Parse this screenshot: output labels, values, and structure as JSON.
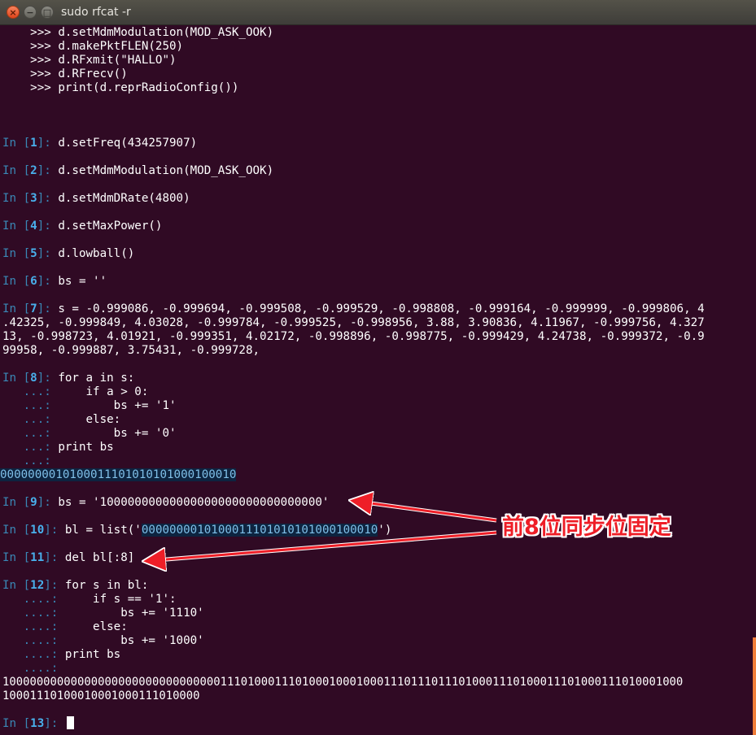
{
  "window": {
    "title": "sudo rfcat -r",
    "close_glyph": "×",
    "min_glyph": "−",
    "max_glyph": "□"
  },
  "colors": {
    "background": "#300a24",
    "prompt": "#3a88b6",
    "prompt_num": "#49b0ec",
    "annotation": "#ee1e27"
  },
  "annotation": "前8位同步位固定",
  "preamble": [
    "    >>> d.setMdmModulation(MOD_ASK_OOK)",
    "    >>> d.makePktFLEN(250)",
    "    >>> d.RFxmit(\"HALLO\")",
    "    >>> d.RFrecv()",
    "    >>> print(d.reprRadioConfig())"
  ],
  "cells": {
    "c1": {
      "num": "1",
      "code": "d.setFreq(434257907)"
    },
    "c2": {
      "num": "2",
      "code": "d.setMdmModulation(MOD_ASK_OOK)"
    },
    "c3": {
      "num": "3",
      "code": "d.setMdmDRate(4800)"
    },
    "c4": {
      "num": "4",
      "code": "d.setMaxPower()"
    },
    "c5": {
      "num": "5",
      "code": "d.lowball()"
    },
    "c6": {
      "num": "6",
      "code": "bs = ''"
    },
    "c7": {
      "num": "7",
      "code": "s = -0.999086, -0.999694, -0.999508, -0.999529, -0.998808, -0.999164, -0.999999, -0.999806, 4",
      "wrap1": ".42325, -0.999849, 4.03028, -0.999784, -0.999525, -0.998956, 3.88, 3.90836, 4.11967, -0.999756, 4.327",
      "wrap2": "13, -0.998723, 4.01921, -0.999351, 4.02172, -0.998896, -0.998775, -0.999429, 4.24738, -0.999372, -0.9",
      "wrap3": "99958, -0.999887, 3.75431, -0.999728,"
    },
    "c8": {
      "num": "8",
      "code": "for a in s:",
      "cont_prompt": "   ...:",
      "l2": "     if a > 0:",
      "l3": "         bs += '1'",
      "l4": "     else:",
      "l5": "         bs += '0'",
      "l6": " print bs",
      "output": "0000000010100011101010101000100010"
    },
    "c9": {
      "num": "9",
      "code": "bs = '10000000000000000000000000000000'"
    },
    "c10": {
      "num": "10",
      "code_pre": "bl = list('",
      "code_hl": "0000000010100011101010101000100010",
      "code_post": "')"
    },
    "c11": {
      "num": "11",
      "code": "del bl[:8]"
    },
    "c12": {
      "num": "12",
      "code": "for s in bl:",
      "cont_prompt": "   ....:",
      "l2": "     if s == '1':",
      "l3": "         bs += '1110'",
      "l4": "     else:",
      "l5": "         bs += '1000'",
      "l6": " print bs",
      "output1": "1000000000000000000000000000000011101000111010001000100011101110111010001110100011101000111010001000",
      "output2": "10001110100010001000111010000"
    },
    "c13": {
      "num": "13"
    }
  },
  "prompt_in": "In [",
  "prompt_close": "]: "
}
